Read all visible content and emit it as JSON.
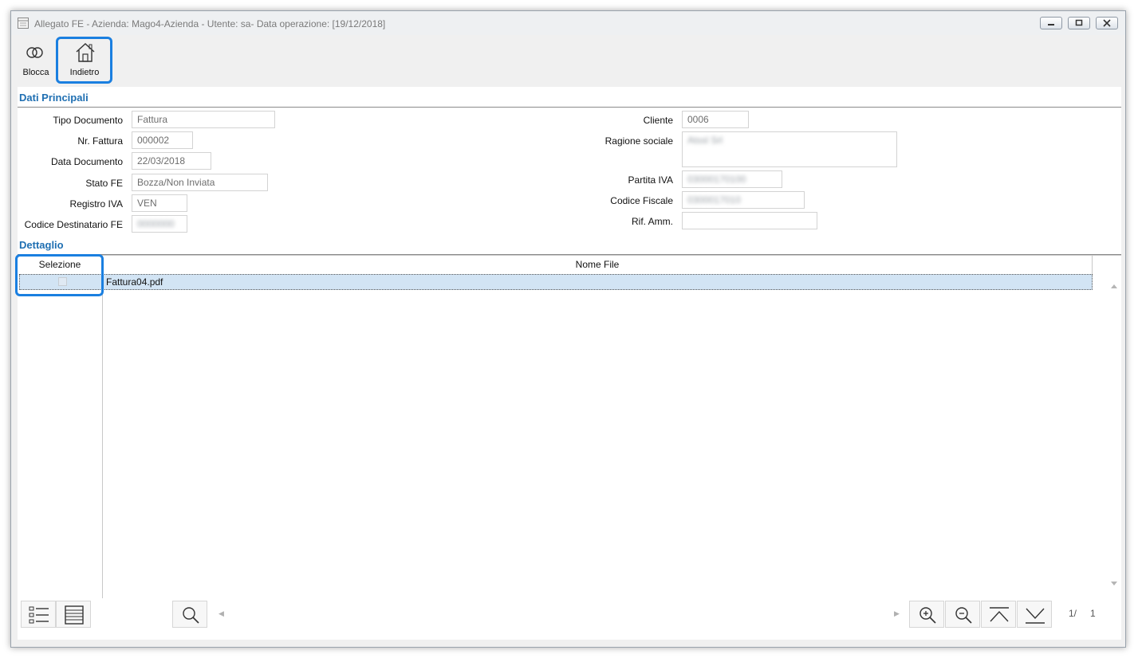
{
  "window": {
    "title": "Allegato FE - Azienda: Mago4-Azienda - Utente: sa- Data operazione: [19/12/2018]"
  },
  "toolbar": {
    "blocca_label": "Blocca",
    "indietro_label": "Indietro"
  },
  "sections": {
    "principali": "Dati Principali",
    "dettaglio": "Dettaglio"
  },
  "fields": {
    "tipo_documento": {
      "label": "Tipo Documento",
      "value": "Fattura"
    },
    "nr_fattura": {
      "label": "Nr. Fattura",
      "value": "000002"
    },
    "data_documento": {
      "label": "Data Documento",
      "value": "22/03/2018"
    },
    "stato_fe": {
      "label": "Stato FE",
      "value": "Bozza/Non Inviata"
    },
    "registro_iva": {
      "label": "Registro IVA",
      "value": "VEN"
    },
    "codice_destinatario": {
      "label": "Codice Destinatario FE",
      "value": "0000000"
    },
    "cliente": {
      "label": "Cliente",
      "value": "0006"
    },
    "ragione_sociale": {
      "label": "Ragione sociale",
      "value": "Atssl Srl"
    },
    "partita_iva": {
      "label": "Partita IVA",
      "value": "03000170100"
    },
    "codice_fiscale": {
      "label": "Codice Fiscale",
      "value": "0300017010"
    },
    "rif_amm": {
      "label": "Rif. Amm.",
      "value": ""
    }
  },
  "grid": {
    "columns": [
      "Selezione",
      "Nome File"
    ],
    "rows": [
      {
        "selected": false,
        "file": "Fattura04.pdf"
      }
    ]
  },
  "pager": {
    "current": "1/",
    "total": "1"
  },
  "colors": {
    "accent": "#1f6fb2",
    "highlight": "#1a7fe0",
    "row_selected": "#d2e4f4"
  }
}
